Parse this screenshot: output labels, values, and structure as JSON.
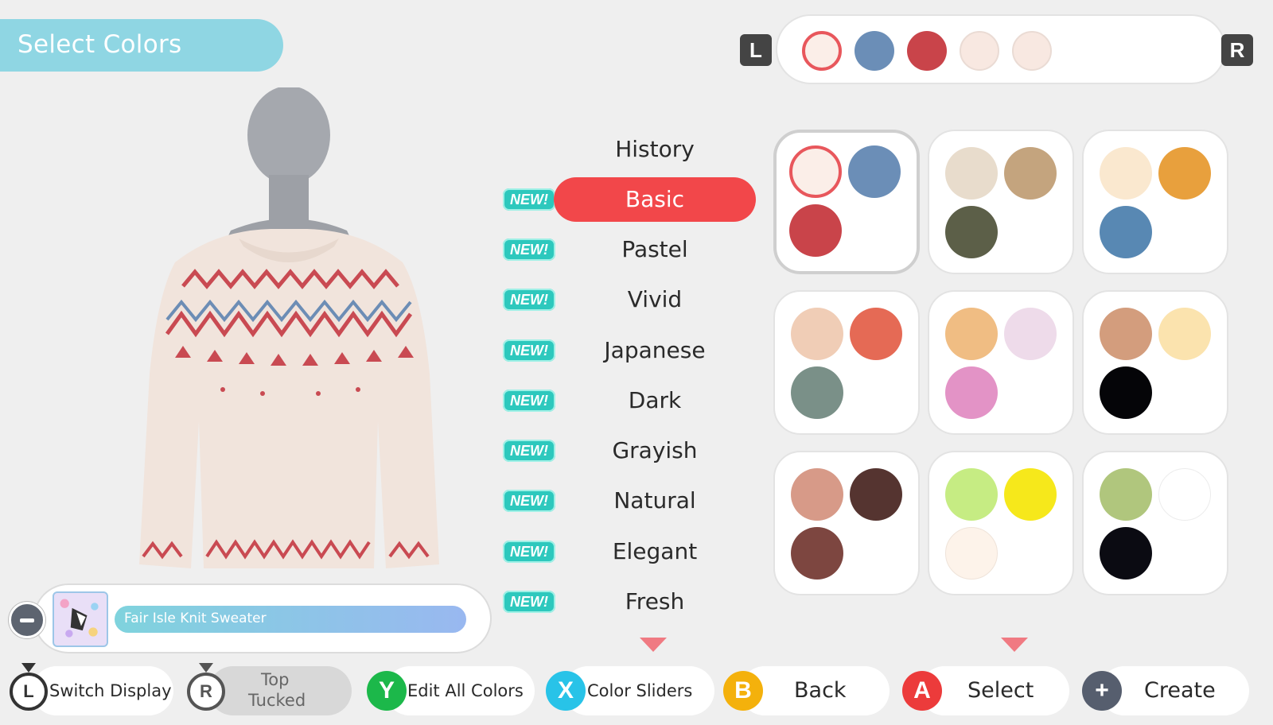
{
  "header": {
    "title": "Select Colors"
  },
  "colors": {
    "active_category": "#f2474a",
    "new_badge": "#2dc8bd",
    "title_banner": "#8fd6e3"
  },
  "palette_strip": {
    "left_button": "L",
    "right_button": "R",
    "swatches": [
      "#fbeee8",
      "#6b8eb7",
      "#c9444a",
      "#f8e8e1",
      "#f8e8e1"
    ]
  },
  "categories": [
    {
      "label": "History",
      "new": false,
      "active": false
    },
    {
      "label": "Basic",
      "new": true,
      "active": true
    },
    {
      "label": "Pastel",
      "new": true,
      "active": false
    },
    {
      "label": "Vivid",
      "new": true,
      "active": false
    },
    {
      "label": "Japanese",
      "new": true,
      "active": false
    },
    {
      "label": "Dark",
      "new": true,
      "active": false
    },
    {
      "label": "Grayish",
      "new": true,
      "active": false
    },
    {
      "label": "Natural",
      "new": true,
      "active": false
    },
    {
      "label": "Elegant",
      "new": true,
      "active": false
    },
    {
      "label": "Fresh",
      "new": true,
      "active": false
    }
  ],
  "new_badge_label": "NEW!",
  "palettes": [
    [
      "#fbeee8",
      "#6b8eb7",
      "#c9444a"
    ],
    [
      "#e8dccc",
      "#c4a47e",
      "#5c5f48"
    ],
    [
      "#fae8cf",
      "#e8a03d",
      "#5888b3"
    ],
    [
      "#f0cdb6",
      "#e56a55",
      "#7a9088"
    ],
    [
      "#f0bd83",
      "#eedbea",
      "#e393c6"
    ],
    [
      "#d39d7d",
      "#fbe3ae",
      "#050508"
    ],
    [
      "#d79a88",
      "#553430",
      "#7d4640"
    ],
    [
      "#c6ec83",
      "#f6e81b",
      "#fdf3ea"
    ],
    [
      "#b0c67d",
      "#ffffff",
      "#0b0b12"
    ]
  ],
  "item": {
    "name": "Fair Isle Knit Sweater",
    "icon": "minus-icon"
  },
  "controls": {
    "switch_display": {
      "button": "L",
      "label": "Switch Display"
    },
    "top_tucked": {
      "button": "R",
      "line1": "Top",
      "line2": "Tucked"
    },
    "edit_all": {
      "button": "Y",
      "label": "Edit All Colors",
      "color": "#1cb84a"
    },
    "sliders": {
      "button": "X",
      "label": "Color Sliders",
      "color": "#28c3e8"
    },
    "back": {
      "button": "B",
      "label": "Back",
      "color": "#f4b10c"
    },
    "select": {
      "button": "A",
      "label": "Select",
      "color": "#ec3b3b"
    },
    "create": {
      "button": "+",
      "label": "Create",
      "color": "#565e6e"
    }
  }
}
